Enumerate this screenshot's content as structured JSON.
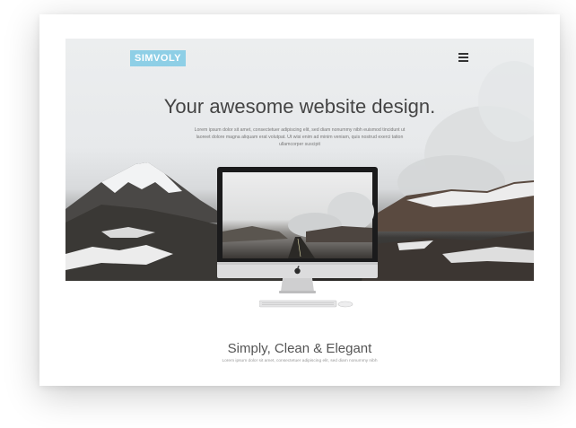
{
  "brand": {
    "logo_text": "SIMVOLY"
  },
  "hero": {
    "title": "Your awesome website design.",
    "description": "Lorem ipsum dolor sit amet, consectetuer adipiscing elit, sed diam nonummy nibh euismod tincidunt ut laoreet dolore magna aliquam erat volutpat. Ut wisi enim ad minim veniam, quis nostrud exerci tation ullamcorper suscipit"
  },
  "section": {
    "title": "Simply, Clean & Elegant",
    "subtitle": "Lorem ipsum dolor sit amet, consectetuer adipiscing elit, sed diam nonummy nibh"
  },
  "icons": {
    "menu": "hamburger-icon",
    "device": "imac-computer",
    "brand_mark": "apple-logo"
  },
  "colors": {
    "logo_bg": "#8ecfe6",
    "title": "#444444",
    "page_bg": "#ffffff"
  }
}
